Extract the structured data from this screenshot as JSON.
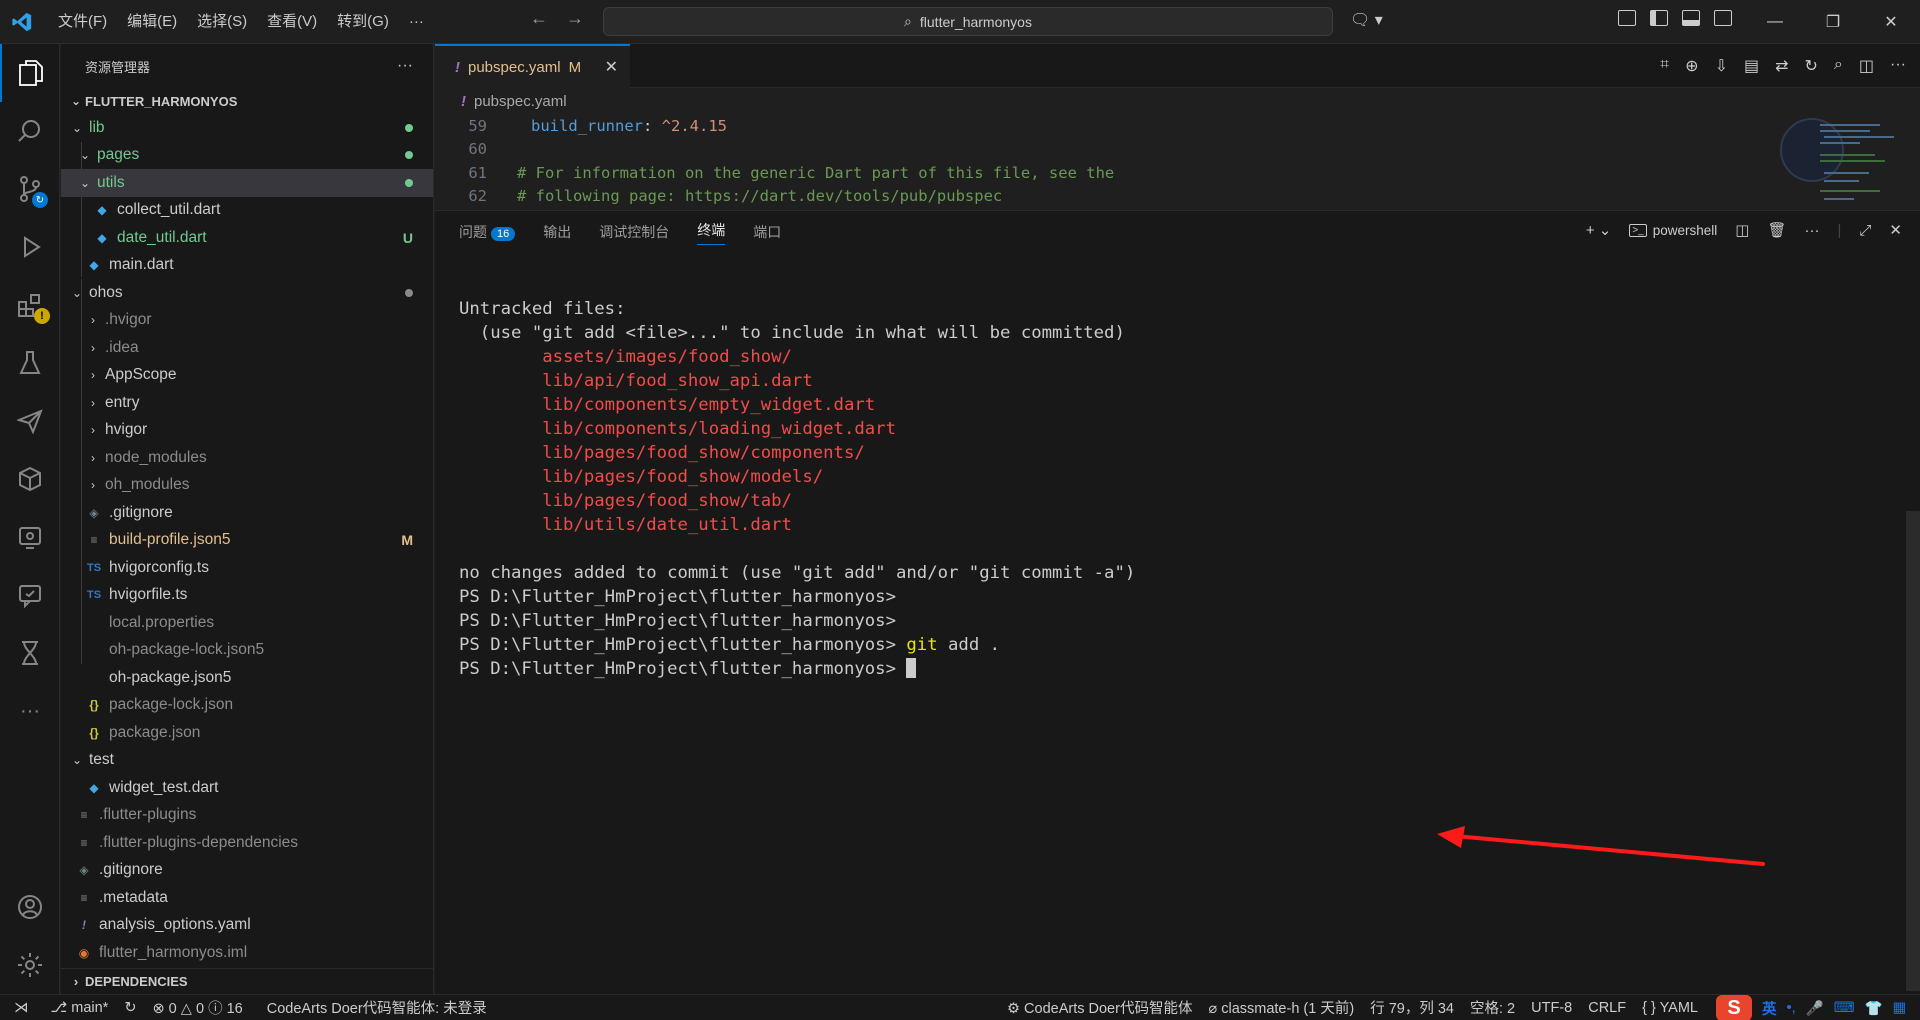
{
  "titlebar": {
    "menu": [
      "文件(F)",
      "编辑(E)",
      "选择(S)",
      "查看(V)",
      "转到(G)",
      "···"
    ],
    "search": "flutter_harmonyos"
  },
  "sidebar": {
    "title": "资源管理器",
    "more": "···",
    "project": "FLUTTER_HARMONYOS",
    "items": [
      {
        "label": "lib",
        "color": "#73c991",
        "dot": "#73c991"
      },
      {
        "label": "pages",
        "color": "#73c991",
        "dot": "#73c991"
      },
      {
        "label": "utils",
        "color": "#73c991",
        "dot": "#73c991"
      },
      {
        "label": "collect_util.dart",
        "color": "#cccccc"
      },
      {
        "label": "date_util.dart",
        "color": "#73c991",
        "status": "U"
      },
      {
        "label": "main.dart",
        "color": "#cccccc"
      },
      {
        "label": "ohos",
        "color": "#cccccc",
        "dot": "#8a8a8a"
      },
      {
        "label": ".hvigor",
        "color": "#8c8c8c"
      },
      {
        "label": ".idea",
        "color": "#8c8c8c"
      },
      {
        "label": "AppScope",
        "color": "#cccccc"
      },
      {
        "label": "entry",
        "color": "#cccccc"
      },
      {
        "label": "hvigor",
        "color": "#cccccc"
      },
      {
        "label": "node_modules",
        "color": "#8c8c8c"
      },
      {
        "label": "oh_modules",
        "color": "#8c8c8c"
      },
      {
        "label": ".gitignore",
        "color": "#cccccc"
      },
      {
        "label": "build-profile.json5",
        "color": "#e2c08d",
        "status": "M"
      },
      {
        "label": "hvigorconfig.ts",
        "color": "#cccccc",
        "icon": "TS"
      },
      {
        "label": "hvigorfile.ts",
        "color": "#cccccc",
        "icon": "TS"
      },
      {
        "label": "local.properties",
        "color": "#8c8c8c"
      },
      {
        "label": "oh-package-lock.json5",
        "color": "#8c8c8c"
      },
      {
        "label": "oh-package.json5",
        "color": "#cccccc"
      },
      {
        "label": "package-lock.json",
        "color": "#8c8c8c",
        "icon": "{}"
      },
      {
        "label": "package.json",
        "color": "#8c8c8c",
        "icon": "{}"
      },
      {
        "label": "test",
        "color": "#cccccc"
      },
      {
        "label": "widget_test.dart",
        "color": "#cccccc"
      },
      {
        "label": ".flutter-plugins",
        "color": "#8c8c8c"
      },
      {
        "label": ".flutter-plugins-dependencies",
        "color": "#8c8c8c"
      },
      {
        "label": ".gitignore",
        "color": "#cccccc"
      },
      {
        "label": ".metadata",
        "color": "#cccccc"
      },
      {
        "label": "analysis_options.yaml",
        "color": "#cccccc",
        "icon": "!"
      },
      {
        "label": "flutter_harmonyos.iml",
        "color": "#8c8c8c"
      }
    ],
    "dependencies": "DEPENDENCIES"
  },
  "editor": {
    "tab": {
      "name": "pubspec.yaml",
      "modified": "M",
      "bang": "!"
    },
    "breadcrumb": "pubspec.yaml",
    "lines": [
      {
        "n": "59",
        "key": "build_runner",
        "colon": ": ",
        "val": "^2.4.15"
      },
      {
        "n": "60"
      },
      {
        "n": "61",
        "comment": "# For information on the generic Dart part of this file, see the"
      },
      {
        "n": "62",
        "comment": "# following page: https://dart.dev/tools/pub/pubspec"
      }
    ]
  },
  "panel": {
    "tabs": [
      "问题",
      "输出",
      "调试控制台",
      "终端",
      "端口"
    ],
    "problems_count": "16",
    "active_tab": "终端",
    "shell": "powershell",
    "terminal": {
      "untracked_header": "Untracked files:",
      "hint": "  (use \"git add <file>...\" to include in what will be committed)",
      "files": [
        "assets/images/food_show/",
        "lib/api/food_show_api.dart",
        "lib/components/empty_widget.dart",
        "lib/components/loading_widget.dart",
        "lib/pages/food_show/components/",
        "lib/pages/food_show/models/",
        "lib/pages/food_show/tab/",
        "lib/utils/date_util.dart"
      ],
      "no_changes": "no changes added to commit (use \"git add\" and/or \"git commit -a\")",
      "prompt": "PS D:\\Flutter_HmProject\\flutter_harmonyos>",
      "cmd_git": "git",
      "cmd_rest": " add ."
    }
  },
  "statusbar": {
    "branch": "main*",
    "errors": "0",
    "warnings": "0",
    "infos": "16",
    "codearts": "CodeArts Doer代码智能体: 未登录",
    "codearts_right": "CodeArts Doer代码智能体",
    "classmate": "classmate-h (1 天前)",
    "position": "行 79，列 34",
    "spaces": "空格: 2",
    "encoding": "UTF-8",
    "eol": "CRLF",
    "language": "YAML",
    "ime_lang": "英"
  },
  "colors": {
    "accent": "#0078d4",
    "git_added": "#73c991",
    "git_modified": "#e2c08d",
    "terminal_red": "#f14c4c",
    "terminal_yellow": "#e5e510",
    "arrow": "#ff1a1a"
  }
}
